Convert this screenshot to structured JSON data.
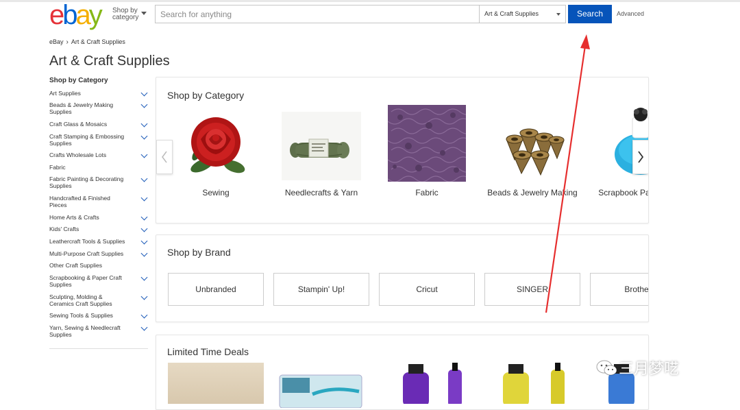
{
  "header": {
    "logo_letters": [
      "e",
      "b",
      "a",
      "y"
    ],
    "logo_colors": [
      "#e53238",
      "#0064d2",
      "#f5af02",
      "#86b817"
    ],
    "shop_by_category_line1": "Shop by",
    "shop_by_category_line2": "category",
    "search_placeholder": "Search for anything",
    "category_selected": "Art & Craft Supplies",
    "search_button": "Search",
    "advanced_link": "Advanced",
    "accent_color": "#0654ba"
  },
  "breadcrumb": {
    "home": "eBay",
    "current": "Art & Craft Supplies"
  },
  "page_title": "Art & Craft Supplies",
  "sidebar": {
    "heading": "Shop by Category",
    "items": [
      {
        "label": "Art Supplies",
        "expandable": true
      },
      {
        "label": "Beads & Jewelry Making Supplies",
        "expandable": true
      },
      {
        "label": "Craft Glass & Mosaics",
        "expandable": true
      },
      {
        "label": "Craft Stamping & Embossing Supplies",
        "expandable": true
      },
      {
        "label": "Crafts Wholesale Lots",
        "expandable": true
      },
      {
        "label": "Fabric",
        "expandable": false
      },
      {
        "label": "Fabric Painting & Decorating Supplies",
        "expandable": true
      },
      {
        "label": "Handcrafted & Finished Pieces",
        "expandable": true
      },
      {
        "label": "Home Arts & Crafts",
        "expandable": true
      },
      {
        "label": "Kids' Crafts",
        "expandable": true
      },
      {
        "label": "Leathercraft Tools & Supplies",
        "expandable": true
      },
      {
        "label": "Multi-Purpose Craft Supplies",
        "expandable": true
      },
      {
        "label": "Other Craft Supplies",
        "expandable": false
      },
      {
        "label": "Scrapbooking & Paper Craft Supplies",
        "expandable": true
      },
      {
        "label": "Sculpting, Molding & Ceramics Craft Supplies",
        "expandable": true
      },
      {
        "label": "Sewing Tools & Supplies",
        "expandable": true
      },
      {
        "label": "Yarn, Sewing & Needlecraft Supplies",
        "expandable": true
      }
    ]
  },
  "shop_by_category": {
    "title": "Shop by Category",
    "items": [
      {
        "label": "Sewing",
        "icon": "rose-patch-image"
      },
      {
        "label": "Needlecrafts & Yarn",
        "icon": "yarn-skein-image"
      },
      {
        "label": "Fabric",
        "icon": "purple-fabric-image"
      },
      {
        "label": "Beads & Jewelry Making",
        "icon": "metal-beads-image"
      },
      {
        "label": "Scrapbook Paper Cra",
        "icon": "paper-punch-image"
      }
    ]
  },
  "shop_by_brand": {
    "title": "Shop by Brand",
    "brands": [
      "Unbranded",
      "Stampin' Up!",
      "Cricut",
      "SINGER",
      "Brother"
    ]
  },
  "limited_time_deals": {
    "title": "Limited Time Deals"
  },
  "watermark": "三月梦呓"
}
